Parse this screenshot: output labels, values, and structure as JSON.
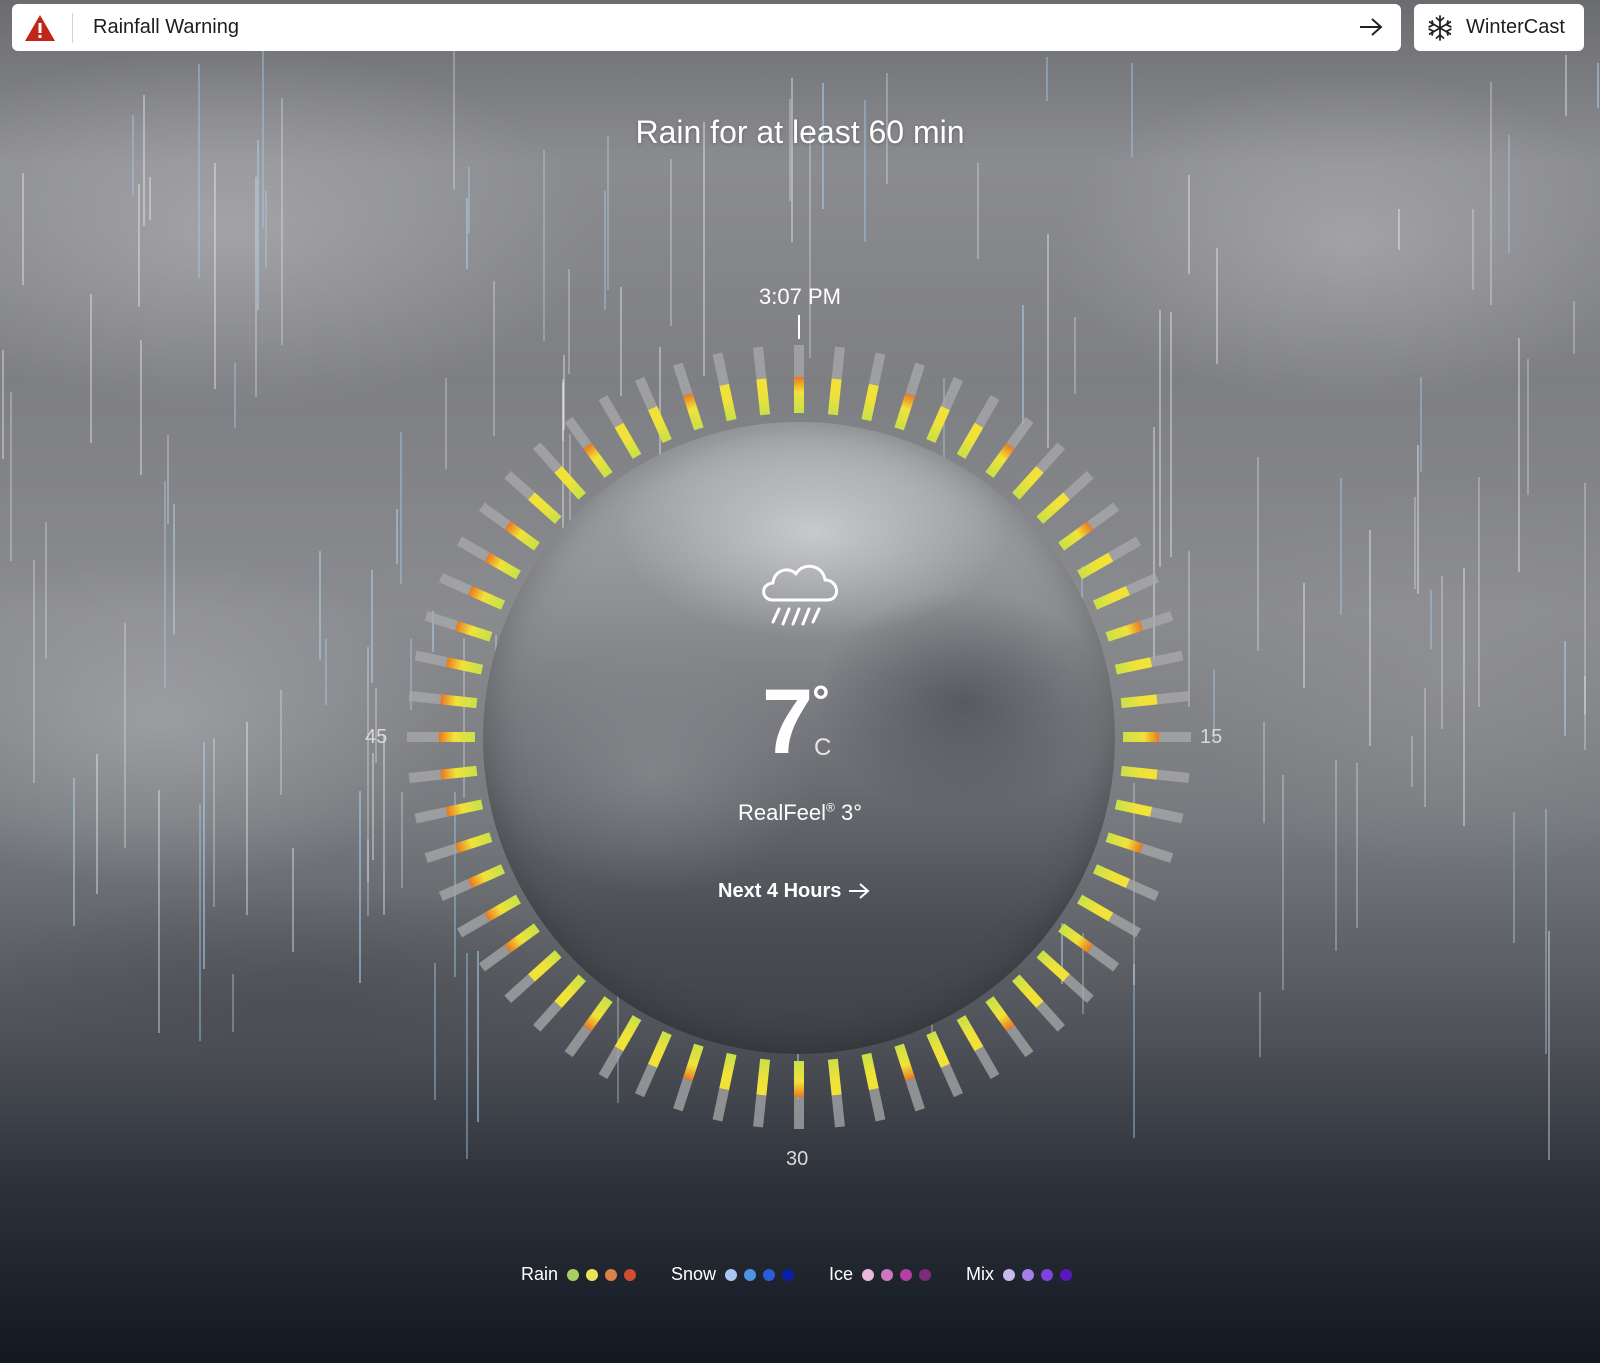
{
  "alert": {
    "title": "Rainfall Warning"
  },
  "wintercast": {
    "label": "WinterCast"
  },
  "headline": "Rain for at least 60 min",
  "dial": {
    "current_time": "3:07 PM",
    "minute_labels": {
      "m15": "15",
      "m30": "30",
      "m45": "45"
    }
  },
  "current": {
    "condition_icon": "cloud-rain-icon",
    "temperature": "7",
    "degree": "°",
    "unit": "C",
    "realfeel_prefix": "RealFeel",
    "realfeel_mark": "®",
    "realfeel_value": "3°"
  },
  "next_link": {
    "label": "Next 4 Hours"
  },
  "legend": [
    {
      "label": "Rain",
      "colors": [
        "#a8cf63",
        "#e9e45a",
        "#d8834a",
        "#d04c32"
      ]
    },
    {
      "label": "Snow",
      "colors": [
        "#a9c7f0",
        "#4f93e2",
        "#2a5ed6",
        "#0a1ea8"
      ]
    },
    {
      "label": "Ice",
      "colors": [
        "#e9b9dc",
        "#cf76c0",
        "#b33fa3",
        "#7e2a7a"
      ]
    },
    {
      "label": "Mix",
      "colors": [
        "#c8b8ee",
        "#a57ee7",
        "#7e42df",
        "#5b16c0"
      ]
    }
  ],
  "colors": {
    "alert_icon": "#c0271b",
    "track": "#a9a9ab",
    "precip_green": "#c8e04a",
    "precip_yellow": "#f1e23a",
    "precip_orange": "#e86a1e"
  }
}
